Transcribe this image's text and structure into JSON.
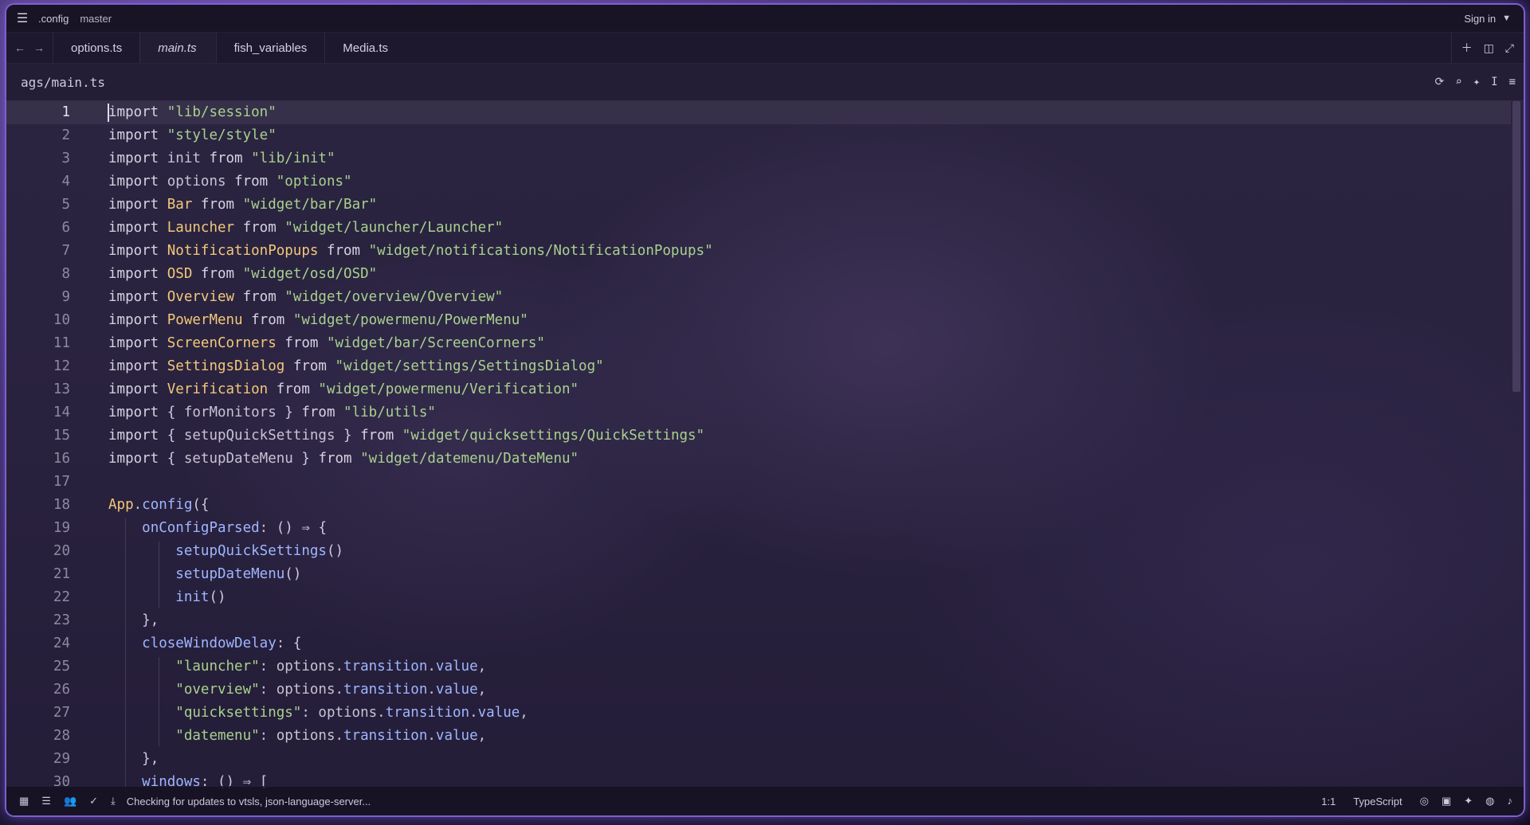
{
  "titlebar": {
    "project": ".config",
    "branch": "master",
    "signin": "Sign in"
  },
  "tabs": [
    {
      "label": "options.ts"
    },
    {
      "label": "main.ts",
      "active": true
    },
    {
      "label": "fish_variables"
    },
    {
      "label": "Media.ts"
    }
  ],
  "breadcrumb": "ags/main.ts",
  "editor": {
    "lines": [
      {
        "n": "1",
        "t": [
          [
            "kw",
            "import "
          ],
          [
            "str",
            "\"lib/session\""
          ]
        ]
      },
      {
        "n": "2",
        "t": [
          [
            "kw",
            "import "
          ],
          [
            "str",
            "\"style/style\""
          ]
        ]
      },
      {
        "n": "3",
        "t": [
          [
            "kw",
            "import "
          ],
          [
            "op",
            "init "
          ],
          [
            "kw",
            "from "
          ],
          [
            "str",
            "\"lib/init\""
          ]
        ]
      },
      {
        "n": "4",
        "t": [
          [
            "kw",
            "import "
          ],
          [
            "op",
            "options "
          ],
          [
            "kw",
            "from "
          ],
          [
            "str",
            "\"options\""
          ]
        ]
      },
      {
        "n": "5",
        "t": [
          [
            "kw",
            "import "
          ],
          [
            "id",
            "Bar "
          ],
          [
            "kw",
            "from "
          ],
          [
            "str",
            "\"widget/bar/Bar\""
          ]
        ]
      },
      {
        "n": "6",
        "t": [
          [
            "kw",
            "import "
          ],
          [
            "id",
            "Launcher "
          ],
          [
            "kw",
            "from "
          ],
          [
            "str",
            "\"widget/launcher/Launcher\""
          ]
        ]
      },
      {
        "n": "7",
        "t": [
          [
            "kw",
            "import "
          ],
          [
            "id",
            "NotificationPopups "
          ],
          [
            "kw",
            "from "
          ],
          [
            "str",
            "\"widget/notifications/NotificationPopups\""
          ]
        ]
      },
      {
        "n": "8",
        "t": [
          [
            "kw",
            "import "
          ],
          [
            "id",
            "OSD "
          ],
          [
            "kw",
            "from "
          ],
          [
            "str",
            "\"widget/osd/OSD\""
          ]
        ]
      },
      {
        "n": "9",
        "t": [
          [
            "kw",
            "import "
          ],
          [
            "id",
            "Overview "
          ],
          [
            "kw",
            "from "
          ],
          [
            "str",
            "\"widget/overview/Overview\""
          ]
        ]
      },
      {
        "n": "10",
        "t": [
          [
            "kw",
            "import "
          ],
          [
            "id",
            "PowerMenu "
          ],
          [
            "kw",
            "from "
          ],
          [
            "str",
            "\"widget/powermenu/PowerMenu\""
          ]
        ]
      },
      {
        "n": "11",
        "t": [
          [
            "kw",
            "import "
          ],
          [
            "id",
            "ScreenCorners "
          ],
          [
            "kw",
            "from "
          ],
          [
            "str",
            "\"widget/bar/ScreenCorners\""
          ]
        ]
      },
      {
        "n": "12",
        "t": [
          [
            "kw",
            "import "
          ],
          [
            "id",
            "SettingsDialog "
          ],
          [
            "kw",
            "from "
          ],
          [
            "str",
            "\"widget/settings/SettingsDialog\""
          ]
        ]
      },
      {
        "n": "13",
        "t": [
          [
            "kw",
            "import "
          ],
          [
            "id",
            "Verification "
          ],
          [
            "kw",
            "from "
          ],
          [
            "str",
            "\"widget/powermenu/Verification\""
          ]
        ]
      },
      {
        "n": "14",
        "t": [
          [
            "kw",
            "import "
          ],
          [
            "br",
            "{ "
          ],
          [
            "op",
            "forMonitors "
          ],
          [
            "br",
            "} "
          ],
          [
            "kw",
            "from "
          ],
          [
            "str",
            "\"lib/utils\""
          ]
        ]
      },
      {
        "n": "15",
        "t": [
          [
            "kw",
            "import "
          ],
          [
            "br",
            "{ "
          ],
          [
            "op",
            "setupQuickSettings "
          ],
          [
            "br",
            "} "
          ],
          [
            "kw",
            "from "
          ],
          [
            "str",
            "\"widget/quicksettings/QuickSettings\""
          ]
        ]
      },
      {
        "n": "16",
        "t": [
          [
            "kw",
            "import "
          ],
          [
            "br",
            "{ "
          ],
          [
            "op",
            "setupDateMenu "
          ],
          [
            "br",
            "} "
          ],
          [
            "kw",
            "from "
          ],
          [
            "str",
            "\"widget/datemenu/DateMenu\""
          ]
        ]
      },
      {
        "n": "17",
        "t": []
      },
      {
        "n": "18",
        "t": [
          [
            "id",
            "App"
          ],
          [
            "op",
            "."
          ],
          [
            "fn",
            "config"
          ],
          [
            "br",
            "({"
          ]
        ]
      },
      {
        "n": "19",
        "t": [
          [
            "op",
            "    "
          ],
          [
            "fn",
            "onConfigParsed"
          ],
          [
            "op",
            ": "
          ],
          [
            "br",
            "() "
          ],
          [
            "op",
            "⇒ "
          ],
          [
            "br",
            "{"
          ]
        ]
      },
      {
        "n": "20",
        "t": [
          [
            "op",
            "        "
          ],
          [
            "fn",
            "setupQuickSettings"
          ],
          [
            "br",
            "()"
          ]
        ]
      },
      {
        "n": "21",
        "t": [
          [
            "op",
            "        "
          ],
          [
            "fn",
            "setupDateMenu"
          ],
          [
            "br",
            "()"
          ]
        ]
      },
      {
        "n": "22",
        "t": [
          [
            "op",
            "        "
          ],
          [
            "fn",
            "init"
          ],
          [
            "br",
            "()"
          ]
        ]
      },
      {
        "n": "23",
        "t": [
          [
            "op",
            "    "
          ],
          [
            "br",
            "},"
          ]
        ]
      },
      {
        "n": "24",
        "t": [
          [
            "op",
            "    "
          ],
          [
            "fn",
            "closeWindowDelay"
          ],
          [
            "op",
            ": "
          ],
          [
            "br",
            "{"
          ]
        ]
      },
      {
        "n": "25",
        "t": [
          [
            "op",
            "        "
          ],
          [
            "str",
            "\"launcher\""
          ],
          [
            "op",
            ": options."
          ],
          [
            "fn",
            "transition"
          ],
          [
            "op",
            "."
          ],
          [
            "fn",
            "value"
          ],
          [
            "op",
            ","
          ]
        ]
      },
      {
        "n": "26",
        "t": [
          [
            "op",
            "        "
          ],
          [
            "str",
            "\"overview\""
          ],
          [
            "op",
            ": options."
          ],
          [
            "fn",
            "transition"
          ],
          [
            "op",
            "."
          ],
          [
            "fn",
            "value"
          ],
          [
            "op",
            ","
          ]
        ]
      },
      {
        "n": "27",
        "t": [
          [
            "op",
            "        "
          ],
          [
            "str",
            "\"quicksettings\""
          ],
          [
            "op",
            ": options."
          ],
          [
            "fn",
            "transition"
          ],
          [
            "op",
            "."
          ],
          [
            "fn",
            "value"
          ],
          [
            "op",
            ","
          ]
        ]
      },
      {
        "n": "28",
        "t": [
          [
            "op",
            "        "
          ],
          [
            "str",
            "\"datemenu\""
          ],
          [
            "op",
            ": options."
          ],
          [
            "fn",
            "transition"
          ],
          [
            "op",
            "."
          ],
          [
            "fn",
            "value"
          ],
          [
            "op",
            ","
          ]
        ]
      },
      {
        "n": "29",
        "t": [
          [
            "op",
            "    "
          ],
          [
            "br",
            "},"
          ]
        ]
      },
      {
        "n": "30",
        "t": [
          [
            "op",
            "    "
          ],
          [
            "fn",
            "windows"
          ],
          [
            "op",
            ": "
          ],
          [
            "br",
            "() "
          ],
          [
            "op",
            "⇒ "
          ],
          [
            "br",
            "["
          ]
        ]
      }
    ]
  },
  "statusbar": {
    "message": "Checking for updates to vtsls, json-language-server...",
    "position": "1:1",
    "language": "TypeScript"
  },
  "icons": {
    "menu": "hamburger-icon",
    "back": "arrow-left-icon",
    "forward": "arrow-right-icon",
    "new": "plus-icon",
    "split": "split-pane-icon",
    "maximize": "maximize-icon"
  },
  "colors": {
    "accent": "#7d5fcf",
    "string": "#a9d18e",
    "identifier": "#f2c879",
    "property": "#9fb6ff"
  }
}
